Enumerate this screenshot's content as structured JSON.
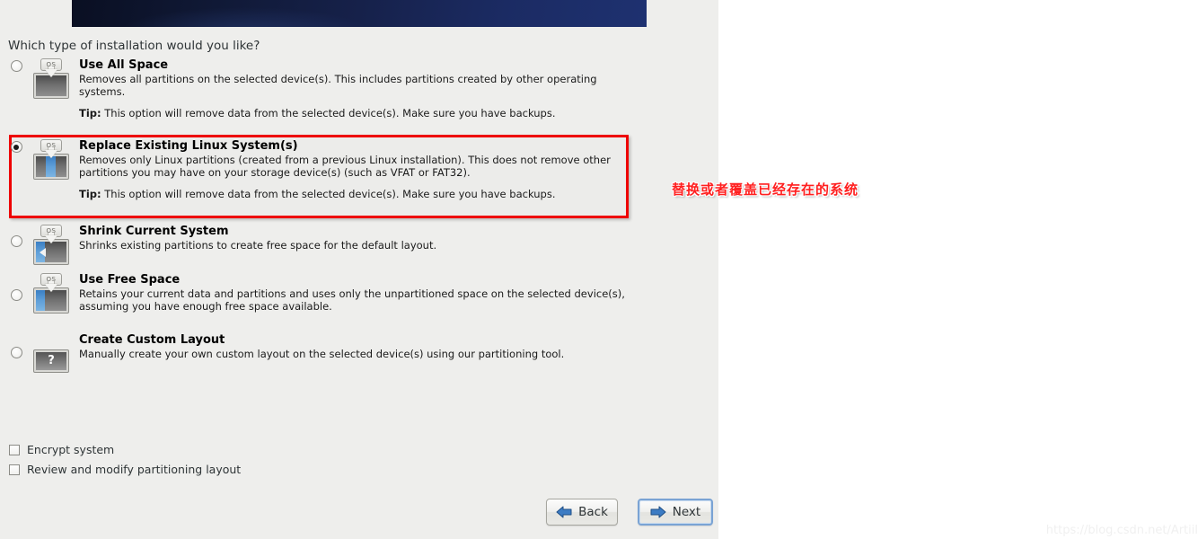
{
  "installer": {
    "question": "Which type of installation would you like?",
    "options": [
      {
        "id": "use-all-space",
        "title": "Use All Space",
        "description": "Removes all partitions on the selected device(s).  This includes partitions created by other operating systems.",
        "tip_label": "Tip:",
        "tip": " This option will remove data from the selected device(s).  Make sure you have backups.",
        "selected": false,
        "icon": "os-disk-full-icon"
      },
      {
        "id": "replace-existing-linux",
        "title": "Replace Existing Linux System(s)",
        "description": "Removes only Linux partitions (created from a previous Linux installation).  This does not remove other partitions you may have on your storage device(s) (such as VFAT or FAT32).",
        "tip_label": "Tip:",
        "tip": " This option will remove data from the selected device(s).  Make sure you have backups.",
        "selected": true,
        "icon": "os-disk-replace-icon"
      },
      {
        "id": "shrink-current-system",
        "title": "Shrink Current System",
        "description": "Shrinks existing partitions to create free space for the default layout.",
        "tip_label": "",
        "tip": "",
        "selected": false,
        "icon": "os-disk-shrink-icon"
      },
      {
        "id": "use-free-space",
        "title": "Use Free Space",
        "description": "Retains your current data and partitions and uses only the unpartitioned space on the selected device(s), assuming you have enough free space available.",
        "tip_label": "",
        "tip": "",
        "selected": false,
        "icon": "os-disk-freespace-icon"
      },
      {
        "id": "create-custom-layout",
        "title": "Create Custom Layout",
        "description": "Manually create your own custom layout on the selected device(s) using our partitioning tool.",
        "tip_label": "",
        "tip": "",
        "selected": false,
        "icon": "question-mark-disk-icon"
      }
    ],
    "icon_tag_text": "OS",
    "question_mark": "?",
    "checkboxes": [
      {
        "id": "encrypt-system",
        "label": "Encrypt system",
        "checked": false
      },
      {
        "id": "review-modify-partitioning",
        "label": "Review and modify partitioning layout",
        "checked": false
      }
    ],
    "buttons": {
      "back": "Back",
      "next": "Next"
    }
  },
  "annotation": {
    "text": "替换或者覆盖已经存在的系统",
    "color": "#ff2020"
  },
  "watermark": {
    "text": "https://blog.csdn.net/Artiil"
  },
  "colors": {
    "panel_bg": "#eeeeec",
    "banner_start": "#0a0f22",
    "banner_end": "#1e3170",
    "highlight_border": "#ee0000",
    "accent_blue": "#3a7fc4"
  }
}
